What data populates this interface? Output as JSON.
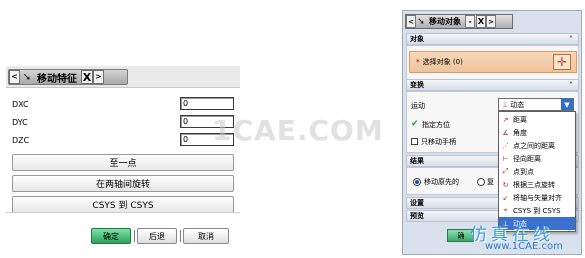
{
  "move_feature_dialog": {
    "tab_title": "移动特征",
    "nav_left": "<",
    "nav_right": ">",
    "close_label": "X",
    "fields": [
      {
        "label": "DXC",
        "value": "0"
      },
      {
        "label": "DYC",
        "value": "0"
      },
      {
        "label": "DZC",
        "value": "0"
      }
    ],
    "buttons": [
      "至一点",
      "在两轴间旋转",
      "CSYS 到 CSYS"
    ],
    "footer": {
      "ok": "确定",
      "back": "后退",
      "cancel": "取消"
    }
  },
  "move_object_dialog": {
    "tab_title": "移动对象",
    "nav_left": "<",
    "nav_right": ">",
    "minimize_label": "-",
    "close_label": "X",
    "object_section": "对象",
    "select_object": "选择对象 (0)",
    "transform_section": "变换",
    "motion_label": "运动",
    "motion_value": "动态",
    "specify_orientation": "指定方位",
    "move_handles_only": "只移动手柄",
    "result_section": "结果",
    "move_original": "移动原先的",
    "copy_original_partial": "复",
    "settings_section": "设置",
    "preview_section": "预览",
    "ok_partial": "确",
    "motion_options": [
      {
        "label": "距离",
        "icon": "distance-icon"
      },
      {
        "label": "角度",
        "icon": "angle-icon"
      },
      {
        "label": "点之间的距离",
        "icon": "point-distance-icon"
      },
      {
        "label": "径向距离",
        "icon": "radial-distance-icon"
      },
      {
        "label": "点到点",
        "icon": "point-to-point-icon"
      },
      {
        "label": "根据三点旋转",
        "icon": "three-point-rotate-icon"
      },
      {
        "label": "将轴与矢量对齐",
        "icon": "align-axis-vector-icon"
      },
      {
        "label": "CSYS 到 CSYS",
        "icon": "csys-to-csys-icon"
      },
      {
        "label": "动态",
        "icon": "dynamic-icon"
      }
    ]
  },
  "watermarks": {
    "center": "1CAE.COM",
    "cn": "仿真在线",
    "url": "www.1CAE.com"
  },
  "colors": {
    "ok_green": "#2aa45f",
    "selection_orange": "#efc49b",
    "menu_highlight": "#3b6fd0",
    "watermark_blue": "#3f9be0"
  }
}
